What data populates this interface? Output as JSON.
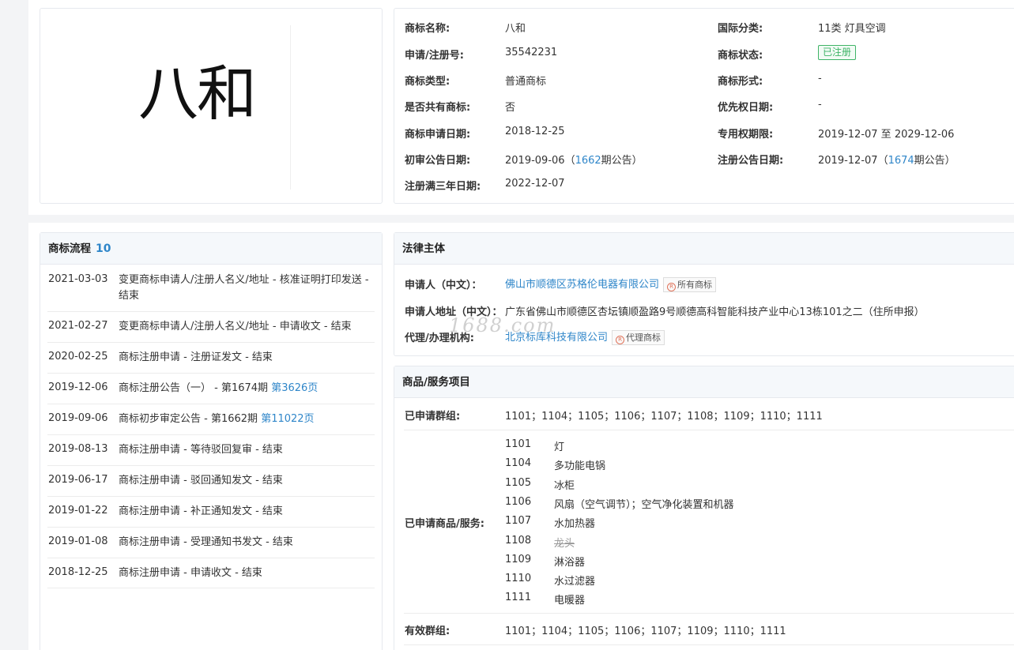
{
  "trademark_image": {
    "mark_text": "八和"
  },
  "info": {
    "rows": [
      {
        "label": "商标名称:",
        "value": "八和"
      },
      {
        "label": "申请/注册号:",
        "value": "35542231"
      },
      {
        "label": "商标类型:",
        "value": "普通商标"
      },
      {
        "label": "是否共有商标:",
        "value": "否"
      },
      {
        "label": "商标申请日期:",
        "value": "2018-12-25"
      },
      {
        "label": "初审公告日期:",
        "value": "2019-09-06",
        "issue_open": "（",
        "issue_no": "1662",
        "issue_suffix": "期公告）"
      },
      {
        "label": "注册满三年日期:",
        "value": "2022-12-07"
      }
    ],
    "right_rows": [
      {
        "label": "国际分类:",
        "value": "11类 灯具空调"
      },
      {
        "label": "商标状态:",
        "value": "已注册"
      },
      {
        "label": "商标形式:",
        "value": "-"
      },
      {
        "label": "优先权日期:",
        "value": "-"
      },
      {
        "label": "专用权期限:",
        "value": "2019-12-07 至 2029-12-06"
      },
      {
        "label": "注册公告日期:",
        "value": "2019-12-07",
        "issue_open": "（",
        "issue_no": "1674",
        "issue_suffix": "期公告）"
      }
    ],
    "status_color": "#3fb467"
  },
  "history": {
    "title": "商标流程",
    "count": "10",
    "items": [
      {
        "date": "2021-03-03",
        "text": "变更商标申请人/注册人名义/地址 - 核准证明打印发送 - 结束"
      },
      {
        "date": "2021-02-27",
        "text": "变更商标申请人/注册人名义/地址 - 申请收文 - 结束"
      },
      {
        "date": "2020-02-25",
        "text": "商标注册申请 - 注册证发文 - 结束"
      },
      {
        "date": "2019-12-06",
        "text": "商标注册公告（一） - 第1674期 ",
        "link": "第3626页"
      },
      {
        "date": "2019-09-06",
        "text": "商标初步审定公告 - 第1662期 ",
        "link": "第11022页"
      },
      {
        "date": "2019-08-13",
        "text": "商标注册申请 - 等待驳回复审 - 结束"
      },
      {
        "date": "2019-06-17",
        "text": "商标注册申请 - 驳回通知发文 - 结束"
      },
      {
        "date": "2019-01-22",
        "text": "商标注册申请 - 补正通知发文 - 结束"
      },
      {
        "date": "2019-01-08",
        "text": "商标注册申请 - 受理通知书发文 - 结束"
      },
      {
        "date": "2018-12-25",
        "text": "商标注册申请 - 申请收文 - 结束"
      }
    ]
  },
  "legal": {
    "title": "法律主体",
    "applicant_label": "申请人（中文）：",
    "applicant": "佛山市顺德区苏格伦电器有限公司",
    "applicant_tag": "所有商标",
    "address_label": "申请人地址（中文）：",
    "address": "广东省佛山市顺德区杏坛镇顺盈路9号顺德高科智能科技产业中心13栋101之二（住所申报）",
    "agent_label": "代理/办理机构:",
    "agent": "北京标库科技有限公司",
    "agent_tag": "代理商标",
    "tag_glyph": "R"
  },
  "goods": {
    "title": "商品/服务项目",
    "groups_label": "已申请群组:",
    "groups": "1101；1104；1105；1106；1107；1108；1109；1110；1111",
    "items_label": "已申请商品/服务:",
    "items": [
      {
        "code": "1101",
        "name": "灯"
      },
      {
        "code": "1104",
        "name": "多功能电锅"
      },
      {
        "code": "1105",
        "name": "冰柜"
      },
      {
        "code": "1106",
        "name": "风扇（空气调节）；空气净化装置和机器"
      },
      {
        "code": "1107",
        "name": "水加热器"
      },
      {
        "code": "1108",
        "name": "龙头"
      },
      {
        "code": "1109",
        "name": "淋浴器"
      },
      {
        "code": "1110",
        "name": "水过滤器"
      },
      {
        "code": "1111",
        "name": "电暖器"
      }
    ],
    "valid_label": "有效群组:",
    "valid_groups": "1101；1104；1105；1106；1107；1109；1110；1111"
  },
  "watermark": "1688.com"
}
